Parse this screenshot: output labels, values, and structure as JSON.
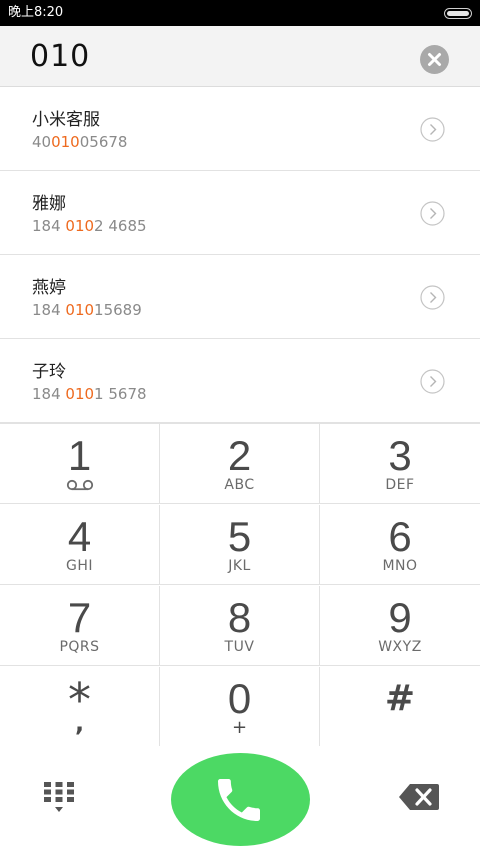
{
  "status_bar": {
    "time": "晚上8:20"
  },
  "dial_input": {
    "value": "010"
  },
  "icons": {
    "clear": "close-circle-icon",
    "detail": "chevron-right-circle-icon",
    "voicemail": "voicemail-icon",
    "keypad_toggle": "dialpad-icon",
    "call": "phone-icon",
    "backspace": "backspace-icon"
  },
  "colors": {
    "highlight": "#ee6a1f",
    "call_button": "#4cd964",
    "status_bar": "#000000"
  },
  "results": [
    {
      "name": "小米客服",
      "number_before": "40",
      "number_match": "010",
      "number_after": "05678"
    },
    {
      "name": "雅娜",
      "number_before": "184 ",
      "number_match": "010",
      "number_after": "2 4685"
    },
    {
      "name": "燕婷",
      "number_before": "184 ",
      "number_match": "010",
      "number_after": "15689"
    },
    {
      "name": "子玲",
      "number_before": "184 ",
      "number_match": "010",
      "number_after": "1 5678"
    }
  ],
  "keypad": {
    "k1": {
      "digit": "1",
      "letters": ""
    },
    "k2": {
      "digit": "2",
      "letters": "ABC"
    },
    "k3": {
      "digit": "3",
      "letters": "DEF"
    },
    "k4": {
      "digit": "4",
      "letters": "GHI"
    },
    "k5": {
      "digit": "5",
      "letters": "JKL"
    },
    "k6": {
      "digit": "6",
      "letters": "MNO"
    },
    "k7": {
      "digit": "7",
      "letters": "PQRS"
    },
    "k8": {
      "digit": "8",
      "letters": "TUV"
    },
    "k9": {
      "digit": "9",
      "letters": "WXYZ"
    },
    "kstar": {
      "symbol": "*",
      "sub": ","
    },
    "k0": {
      "digit": "0",
      "sub": "+"
    },
    "khash": {
      "symbol": "#"
    }
  }
}
